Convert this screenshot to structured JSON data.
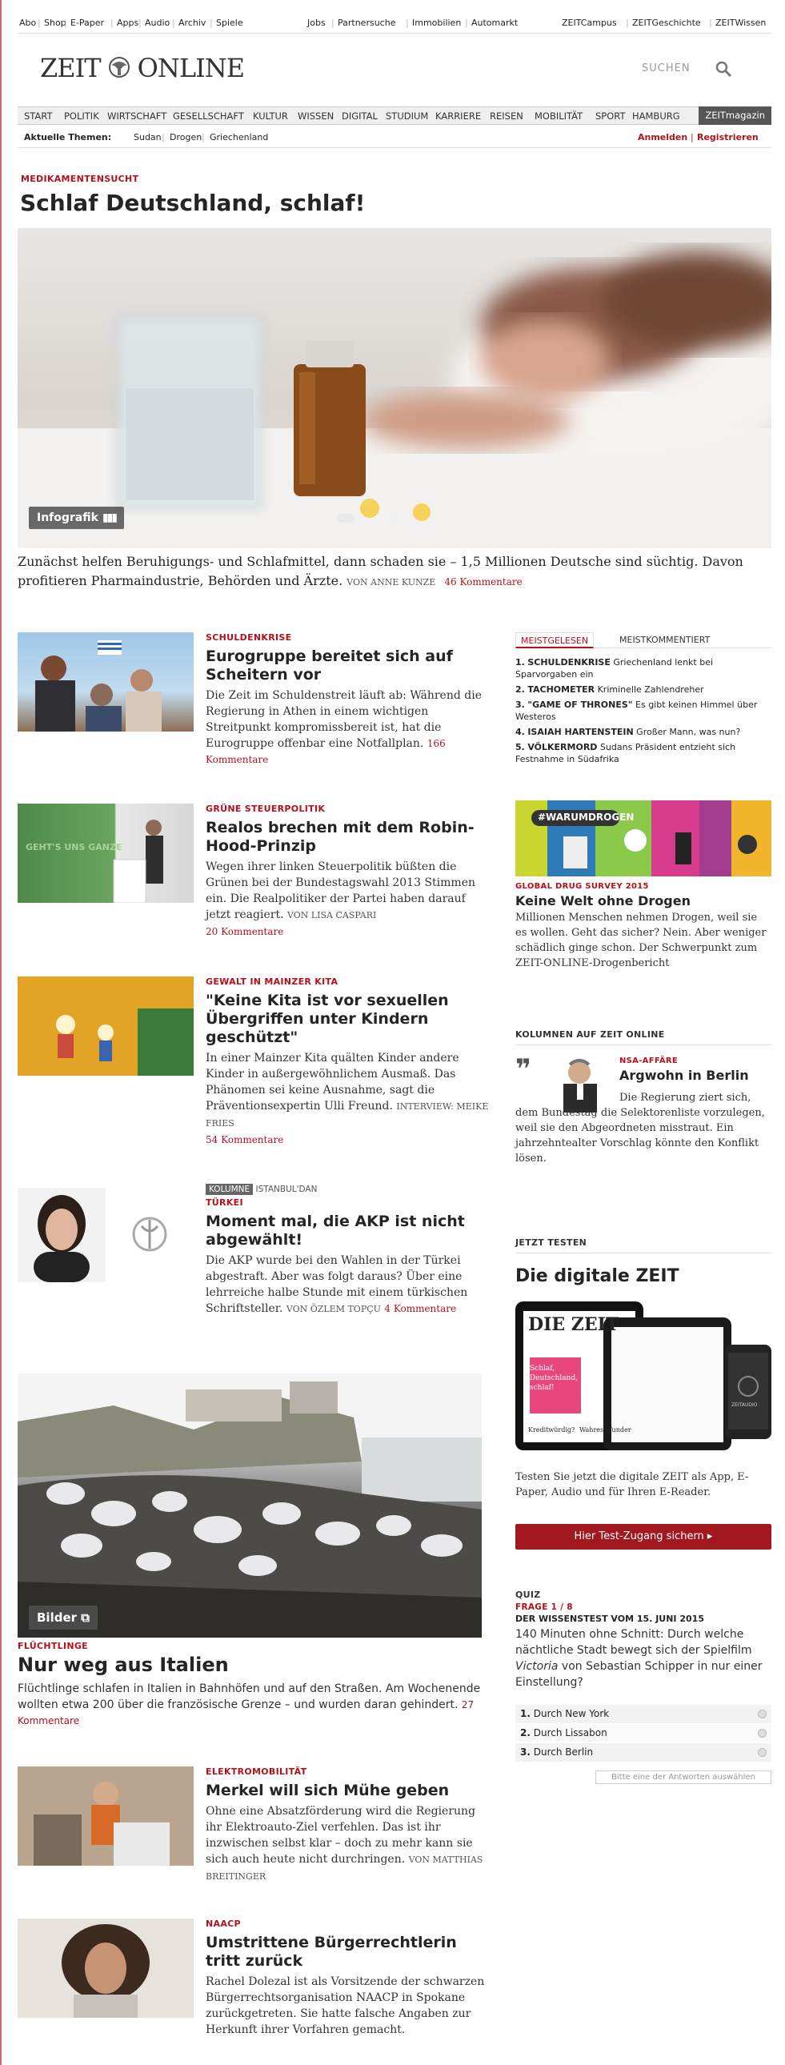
{
  "service": {
    "left": [
      "Abo",
      "Shop",
      "E-Paper",
      "Apps",
      "Audio",
      "Archiv",
      "Spiele"
    ],
    "mid": [
      "Jobs",
      "Partnersuche",
      "Immobilien",
      "Automarkt"
    ],
    "right": [
      "ZEITCampus",
      "ZEITGeschichte",
      "ZEITWissen"
    ]
  },
  "logo": {
    "left": "ZEIT",
    "right": "ONLINE"
  },
  "search": {
    "label": "SUCHEN"
  },
  "nav": {
    "items": [
      "START",
      "POLITIK",
      "WIRTSCHAFT",
      "GESELLSCHAFT",
      "KULTUR",
      "WISSEN",
      "DIGITAL",
      "STUDIUM",
      "KARRIERE",
      "REISEN",
      "MOBILITÄT",
      "SPORT",
      "HAMBURG"
    ],
    "magazin": "ZEITmagazin"
  },
  "topics": {
    "label": "Aktuelle Themen:",
    "items": [
      "Sudan",
      "Drogen",
      "Griechenland"
    ],
    "login": "Anmelden",
    "register": "Registrieren"
  },
  "lead": {
    "kicker": "MEDIKAMENTENSUCHT",
    "title": "Schlaf Deutschland, schlaf!",
    "badge": "Infografik",
    "teaser": "Zunächst helfen Beruhigungs- und Schlafmittel, dann schaden sie – 1,5 Millionen Deutsche sind süchtig. Davon profitieren Pharmaindustrie, Behörden und Ärzte.",
    "author": "VON ANNE KUNZE",
    "comments": "46 Kommentare"
  },
  "articles": [
    {
      "kicker": "SCHULDENKRISE",
      "title": "Eurogruppe bereitet sich auf Scheitern vor",
      "teaser": "Die Zeit im Schuldenstreit läuft ab: Während die Regierung in Athen in einem wichtigen Streitpunkt kompromissbereit ist, hat die Eurogruppe offenbar eine Notfallplan.",
      "author": "",
      "comments": "166 Kommentare"
    },
    {
      "kicker": "GRÜNE STEUERPOLITIK",
      "title": "Realos brechen mit dem Robin-Hood-Prinzip",
      "teaser": "Wegen ihrer linken Steuerpolitik büßten die Grünen bei der Bundestagswahl 2013 Stimmen ein. Die Realpolitiker der Partei haben darauf jetzt reagiert.",
      "author": "VON LISA CASPARI",
      "comments": "20 Kommentare"
    },
    {
      "kicker": "GEWALT IN MAINZER KITA",
      "title": "\"Keine Kita ist vor sexuellen Übergriffen unter Kindern geschützt\"",
      "teaser": "In einer Mainzer Kita quälten Kinder andere Kinder in außergewöhnlichem Ausmaß. Das Phänomen sei keine Ausnahme, sagt die Präventionsexpertin Ulli Freund.",
      "author": "INTERVIEW: MEIKE FRIES",
      "comments": "54 Kommentare"
    },
    {
      "label": "KOLUMNE",
      "series": "ISTANBUL'DAN",
      "kicker": "TÜRKEI",
      "title": "Moment mal, die AKP ist nicht abgewählt!",
      "teaser": "Die AKP wurde bei den Wahlen in der Türkei abgestraft. Aber was folgt daraus? Über eine lehrreiche halbe Stunde mit einem türkischen Schriftsteller.",
      "author": "VON ÖZLEM TOPÇU",
      "comments": "4 Kommentare"
    }
  ],
  "photo": {
    "badge": "Bilder",
    "kicker": "FLÜCHTLINGE",
    "title": "Nur weg aus Italien",
    "teaser": "Flüchtlinge schlafen in Italien in Bahnhöfen und auf den Straßen. Am Wochenende wollten etwa 200 über die französische Grenze – und wurden daran gehindert.",
    "comments": "27 Kommentare"
  },
  "articles2": [
    {
      "kicker": "ELEKTROMOBILITÄT",
      "title": "Merkel will sich Mühe geben",
      "teaser": "Ohne eine Absatzförderung wird die Regierung ihr Elektroauto-Ziel verfehlen. Das ist ihr inzwischen selbst klar – doch zu mehr kann sie sich auch heute nicht durchringen.",
      "author": "VON MATTHIAS BREITINGER",
      "comments": ""
    },
    {
      "kicker": "NAACP",
      "title": "Umstrittene Bürgerrechtlerin tritt zurück",
      "teaser": "Rachel Dolezal ist als Vorsitzende der schwarzen Bürgerrechtsorganisation NAACP in Spokane zurückgetreten. Sie hatte falsche Angaben zur Herkunft ihrer Vorfahren gemacht.",
      "author": "",
      "comments": ""
    }
  ],
  "sidebar": {
    "tab_active": "MEISTGELESEN",
    "tab_other": "MEISTKOMMENTIERT",
    "most": [
      {
        "num": "1.",
        "kicker": "SCHULDENKRISE",
        "text": "Griechenland lenkt bei Sparvorgaben ein"
      },
      {
        "num": "2.",
        "kicker": "TACHOMETER",
        "text": "Kriminelle Zahlendreher"
      },
      {
        "num": "3.",
        "kicker": "\"GAME OF THRONES\"",
        "text": "Es gibt keinen Himmel über Westeros"
      },
      {
        "num": "4.",
        "kicker": "ISAIAH HARTENSTEIN",
        "text": "Großer Mann, was nun?"
      },
      {
        "num": "5.",
        "kicker": "VÖLKERMORD",
        "text": "Sudans Präsident entzieht sich Festnahme in Südafrika"
      }
    ],
    "drugs": {
      "hashtag": "#WARUMDROGEN",
      "kicker": "GLOBAL DRUG SURVEY 2015",
      "title": "Keine Welt ohne Drogen",
      "teaser": "Millionen Menschen nehmen Drogen, weil sie es wollen. Geht das sicher? Nein. Aber weniger schädlich ginge schon. Der Schwerpunkt zum ZEIT-ONLINE-Drogenbericht"
    },
    "columns": {
      "head": "KOLUMNEN AUF ZEIT ONLINE",
      "kicker": "NSA-AFFÄRE",
      "title": "Argwohn in Berlin",
      "teaser": "Die Regierung ziert sich, dem Bundestag die Selektorenliste vorzulegen, weil sie den Abgeordneten misstraut. Ein jahrzehntealter Vorschlag könnte den Konflikt lösen."
    },
    "digital": {
      "head": "JETZT TESTEN",
      "title": "Die digitale ZEIT",
      "paper_title": "DIE ZEIT",
      "paper_head": "Schlaf, Deutschland, schlaf!",
      "paper_bottom_left": "Kreditwürdig?",
      "paper_bottom_right": "Wahres Wunder",
      "phone_label": "ZEITAUDIO",
      "text": "Testen Sie jetzt die digitale ZEIT als App, E-Paper, Audio und für Ihren E-Reader.",
      "button": "Hier Test-Zugang sichern ▸"
    },
    "quiz": {
      "head": "QUIZ",
      "progress": "FRAGE 1 / 8",
      "title": "DER WISSENSTEST VOM 15. JUNI 2015",
      "question_a": " 140 Minuten ohne Schnitt: Durch welche nächtliche Stadt bewegt sich der Spielfilm ",
      "question_film": "Victoria",
      "question_b": " von Sebastian Schipper in nur einer Einstellung?",
      "options": [
        {
          "num": "1.",
          "label": "Durch New York"
        },
        {
          "num": "2.",
          "label": "Durch Lissabon"
        },
        {
          "num": "3.",
          "label": "Durch Berlin"
        }
      ],
      "hint": "Bitte eine der Antworten auswählen"
    }
  }
}
